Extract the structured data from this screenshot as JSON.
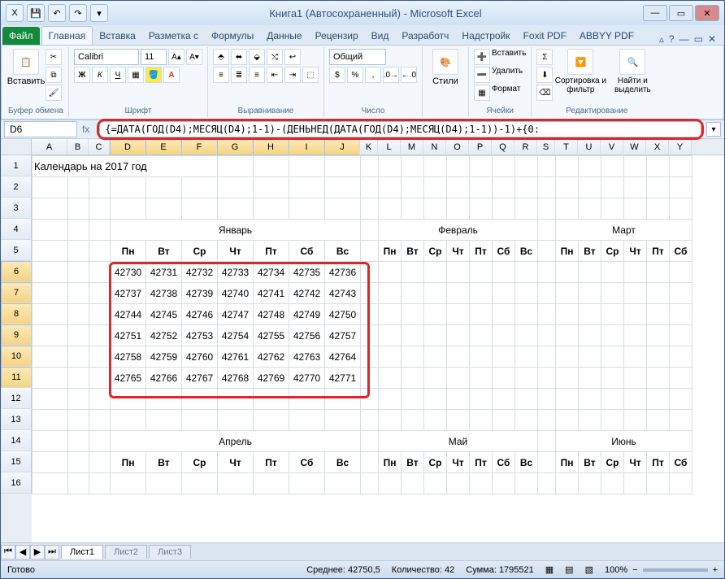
{
  "window": {
    "title": "Книга1 (Автосохраненный) - Microsoft Excel"
  },
  "qat": {
    "excel": "X",
    "save": "💾",
    "undo": "↶",
    "redo": "↷",
    "more": "▾"
  },
  "tabs": {
    "file": "Файл",
    "items": [
      "Главная",
      "Вставка",
      "Разметка с",
      "Формулы",
      "Данные",
      "Рецензир",
      "Вид",
      "Разработч",
      "Надстройк",
      "Foxit PDF",
      "ABBYY PDF"
    ],
    "active_index": 0,
    "help": "?"
  },
  "ribbon": {
    "groups": {
      "clipboard": {
        "label": "Буфер обмена",
        "paste": "Вставить"
      },
      "font": {
        "label": "Шрифт",
        "name": "Calibri",
        "size": "11"
      },
      "alignment": {
        "label": "Выравнивание"
      },
      "number": {
        "label": "Число",
        "format": "Общий"
      },
      "styles": {
        "label": "Стили",
        "btn": "Стили"
      },
      "cells": {
        "label": "Ячейки",
        "insert": "Вставить",
        "delete": "Удалить",
        "format": "Формат"
      },
      "editing": {
        "label": "Редактирование",
        "sort": "Сортировка и фильтр",
        "find": "Найти и выделить"
      }
    }
  },
  "namebox": {
    "ref": "D6",
    "fx": "fx"
  },
  "formula": "{=ДАТА(ГОД(D4);МЕСЯЦ(D4);1-1)-(ДЕНЬНЕД(ДАТА(ГОД(D4);МЕСЯЦ(D4);1-1))-1)+{0:",
  "columns": [
    "A",
    "B",
    "C",
    "D",
    "E",
    "F",
    "G",
    "H",
    "I",
    "J",
    "K",
    "L",
    "M",
    "N",
    "O",
    "P",
    "Q",
    "R",
    "S",
    "T",
    "U",
    "V",
    "W",
    "X",
    "Y"
  ],
  "rows_visible": [
    1,
    2,
    3,
    4,
    5,
    6,
    7,
    8,
    9,
    10,
    11,
    12,
    13,
    14,
    15,
    16
  ],
  "selected_rows": [
    6,
    7,
    8,
    9,
    10,
    11
  ],
  "selected_cols": [
    "D",
    "E",
    "F",
    "G",
    "H",
    "I",
    "J"
  ],
  "sheet": {
    "title_cell": "Календарь на 2017 год",
    "months_row1": [
      "Январь",
      "Февраль",
      "Март"
    ],
    "months_row2": [
      "Апрель",
      "Май",
      "Июнь"
    ],
    "day_headers": [
      "Пн",
      "Вт",
      "Ср",
      "Чт",
      "Пт",
      "Сб",
      "Вс"
    ],
    "january_values": [
      [
        42730,
        42731,
        42732,
        42733,
        42734,
        42735,
        42736
      ],
      [
        42737,
        42738,
        42739,
        42740,
        42741,
        42742,
        42743
      ],
      [
        42744,
        42745,
        42746,
        42747,
        42748,
        42749,
        42750
      ],
      [
        42751,
        42752,
        42753,
        42754,
        42755,
        42756,
        42757
      ],
      [
        42758,
        42759,
        42760,
        42761,
        42762,
        42763,
        42764
      ],
      [
        42765,
        42766,
        42767,
        42768,
        42769,
        42770,
        42771
      ]
    ]
  },
  "sheet_tabs": {
    "items": [
      "Лист1",
      "Лист2",
      "Лист3"
    ],
    "active_index": 0
  },
  "statusbar": {
    "ready": "Готово",
    "average_label": "Среднее:",
    "average": "42750,5",
    "count_label": "Количество:",
    "count": "42",
    "sum_label": "Сумма:",
    "sum": "1795521",
    "zoom": "100%"
  }
}
